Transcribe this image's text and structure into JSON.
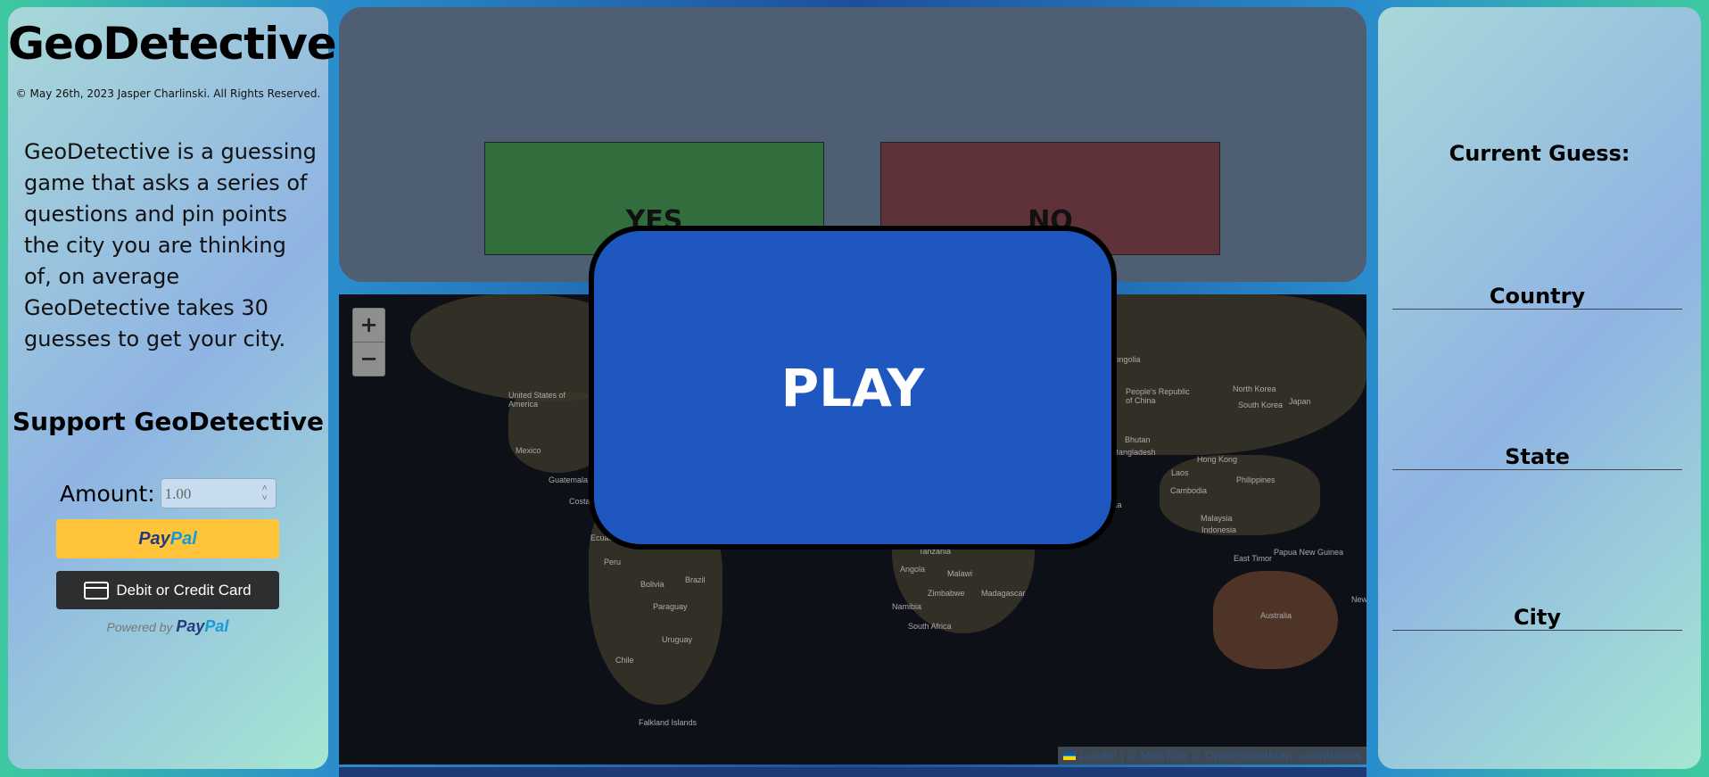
{
  "app": {
    "title": "GeoDetective",
    "copyright": "© May 26th, 2023 Jasper Charlinski. All Rights Reserved.",
    "description": "GeoDetective is a guessing game that asks a series of questions and pin points the city you are thinking of, on average GeoDetective takes 30 guesses to get your city."
  },
  "support": {
    "title": "Support GeoDetective",
    "amount_label": "Amount:",
    "amount_value": "1.00",
    "paypal_dark": "Pay",
    "paypal_light": "Pal",
    "card_label": "Debit or Credit Card",
    "powered_by": "Powered by",
    "powered_brand_dark": "Pay",
    "powered_brand_light": "Pal"
  },
  "question": {
    "yes_label": "YES",
    "no_label": "NO"
  },
  "play": {
    "label": "PLAY"
  },
  "map": {
    "zoom_in": "+",
    "zoom_out": "−",
    "attribution_leaflet": "Leaflet",
    "attribution_rest": " | © MapTiler © OpenStreetMap contributors",
    "labels": [
      "United States of America",
      "Mexico",
      "Guatemala",
      "Costa",
      "Ecuad",
      "Peru",
      "Bolivia",
      "Brazil",
      "Paraguay",
      "Uruguay",
      "Chile",
      "Falkland Islands",
      "Mongolia",
      "North Korea",
      "South Korea",
      "Japan",
      "People's Republic of China",
      "Bhutan",
      "Bangladesh",
      "Hong Kong",
      "Laos",
      "Philippines",
      "Cambodia",
      "Malaysia",
      "Indonesia",
      "East Timor",
      "Papua New Guinea",
      "Australia",
      "New",
      "Angola",
      "Malawi",
      "Zimbabwe",
      "Madagascar",
      "Namibia",
      "South Africa",
      "Tanzania",
      "ka"
    ]
  },
  "guess": {
    "title": "Current Guess:",
    "country_label": "Country",
    "state_label": "State",
    "city_label": "City"
  },
  "colors": {
    "play": "#1f57c0",
    "yes": "#316d3d",
    "no": "#5f3239",
    "paypal": "#ffc43a"
  }
}
